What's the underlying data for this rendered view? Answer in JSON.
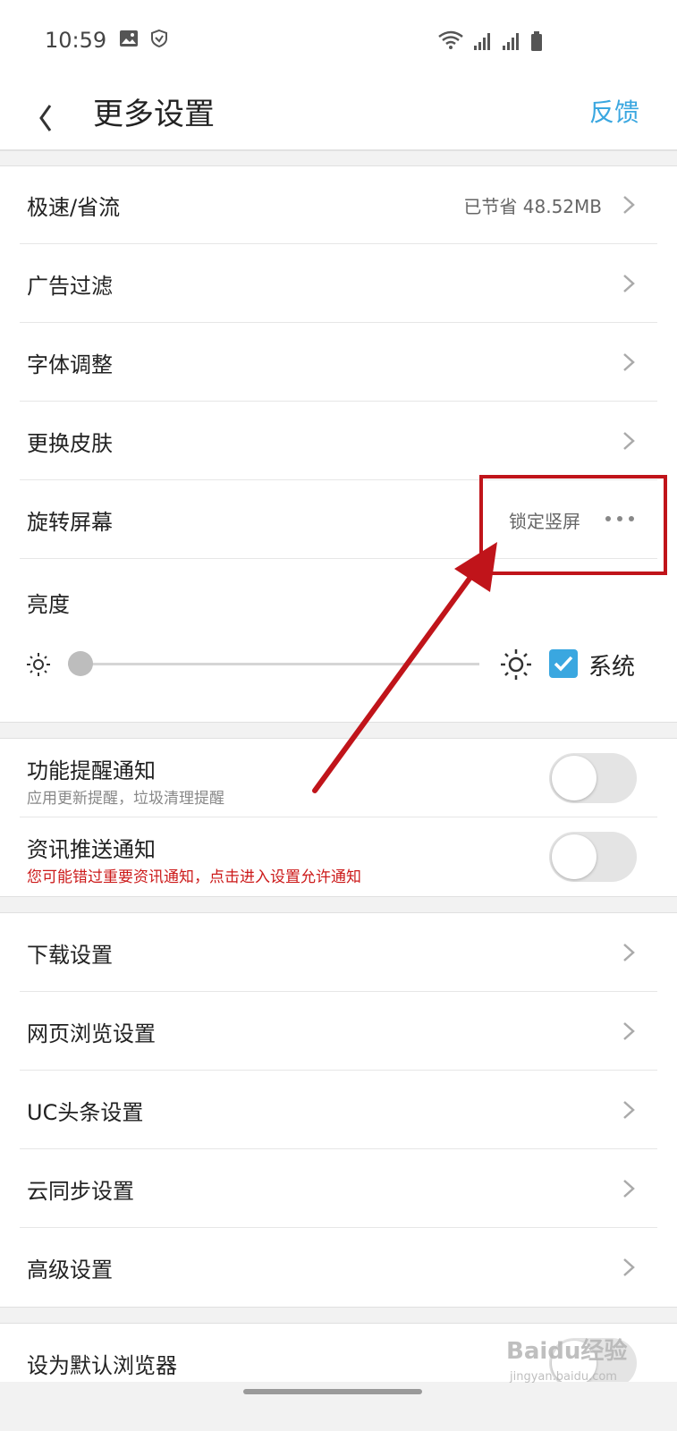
{
  "status_bar": {
    "time": "10:59"
  },
  "header": {
    "title": "更多设置",
    "feedback_label": "反馈"
  },
  "group1": {
    "speed": {
      "label": "极速/省流",
      "value": "已节省 48.52MB"
    },
    "adblock": {
      "label": "广告过滤"
    },
    "font": {
      "label": "字体调整"
    },
    "skin": {
      "label": "更换皮肤"
    },
    "rotate": {
      "label": "旋转屏幕",
      "value": "锁定竖屏"
    },
    "brightness": {
      "label": "亮度",
      "system_label": "系统",
      "level_fraction": 0.0,
      "system_checked": true
    }
  },
  "group2": {
    "feature_notify": {
      "label": "功能提醒通知",
      "sub": "应用更新提醒，垃圾清理提醒",
      "on": false
    },
    "news_notify": {
      "label": "资讯推送通知",
      "sub": "您可能错过重要资讯通知，点击进入设置允许通知",
      "on": false
    }
  },
  "group3": {
    "download": {
      "label": "下载设置"
    },
    "browse": {
      "label": "网页浏览设置"
    },
    "uc_news": {
      "label": "UC头条设置"
    },
    "cloud_sync": {
      "label": "云同步设置"
    },
    "advanced": {
      "label": "高级设置"
    }
  },
  "group4": {
    "default_browser": {
      "label": "设为默认浏览器"
    }
  },
  "watermark": {
    "text": "Baidu经验",
    "sub": "jingyan.baidu.com"
  },
  "colors": {
    "accent": "#3aa7e0",
    "warn": "#cc1a1a",
    "annotation": "#c0141a"
  }
}
